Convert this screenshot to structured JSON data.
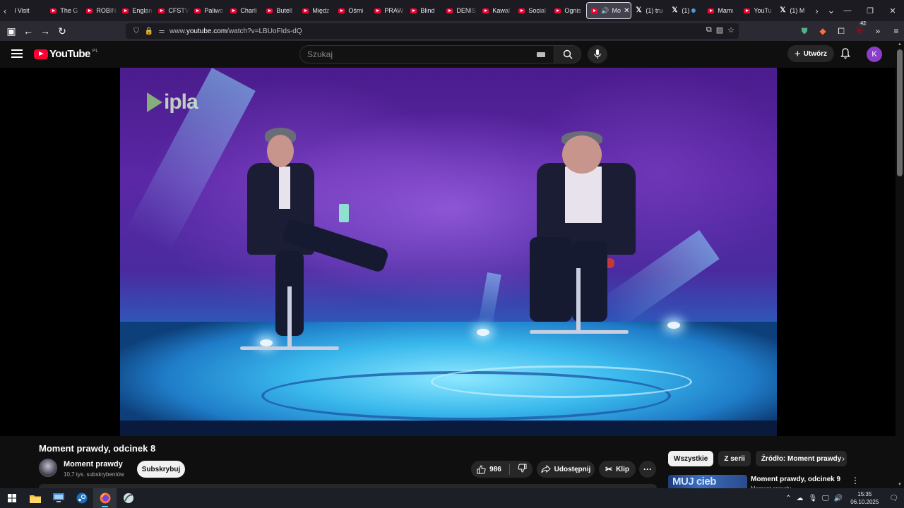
{
  "browser": {
    "tabs": [
      {
        "label": "l Visit",
        "icon": "none"
      },
      {
        "label": "The G",
        "icon": "youtube"
      },
      {
        "label": "ROBIN",
        "icon": "youtube"
      },
      {
        "label": "Englan",
        "icon": "youtube"
      },
      {
        "label": "CFSTV",
        "icon": "youtube"
      },
      {
        "label": "Paliwo",
        "icon": "youtube"
      },
      {
        "label": "Charli",
        "icon": "youtube"
      },
      {
        "label": "Butell",
        "icon": "youtube"
      },
      {
        "label": "Międz",
        "icon": "youtube"
      },
      {
        "label": "Ośmi",
        "icon": "youtube"
      },
      {
        "label": "PRAW",
        "icon": "youtube"
      },
      {
        "label": "Blind",
        "icon": "youtube"
      },
      {
        "label": "DENIS",
        "icon": "youtube"
      },
      {
        "label": "Kawal",
        "icon": "youtube"
      },
      {
        "label": "Social",
        "icon": "youtube"
      },
      {
        "label": "Ognis",
        "icon": "youtube"
      },
      {
        "label": "Mo",
        "icon": "youtube",
        "active": true
      },
      {
        "label": "(1) tru",
        "icon": "x"
      },
      {
        "label": "(1)",
        "icon": "x"
      },
      {
        "label": "Mamı",
        "icon": "youtube"
      },
      {
        "label": "YouTu",
        "icon": "youtube"
      },
      {
        "label": "(1) M",
        "icon": "x"
      }
    ],
    "url_prefix": "www.",
    "url_host": "youtube.com",
    "url_path": "/watch?v=LBUoFIds-dQ",
    "extension_badge": "42"
  },
  "youtube": {
    "logo_text": "YouTube",
    "country_code": "PL",
    "search_placeholder": "Szukaj",
    "create_label": "Utwórz",
    "avatar_letter": "K"
  },
  "video": {
    "watermark": "ipla",
    "title": "Moment prawdy, odcinek 8",
    "channel_name": "Moment prawdy",
    "subscribers": "10,7 tys. subskrybentów",
    "subscribe_label": "Subskrybuj",
    "likes": "986",
    "share_label": "Udostępnij",
    "clip_label": "Klip",
    "more_label": "···"
  },
  "sidebar": {
    "chips": [
      {
        "label": "Wszystkie",
        "active": true
      },
      {
        "label": "Z serii",
        "active": false
      },
      {
        "label": "Źródło: Moment prawdy",
        "active": false
      }
    ],
    "recommendation": {
      "thumb_text": "MUJ cieb",
      "title": "Moment prawdy, odcinek 9",
      "channel": "Moment prawdy"
    }
  },
  "taskbar": {
    "time": "15:35",
    "date": "06.10.2025"
  },
  "colors": {
    "youtube_red": "#ff0033",
    "background": "#0f0f0f",
    "avatar": "#8a3ec9"
  }
}
